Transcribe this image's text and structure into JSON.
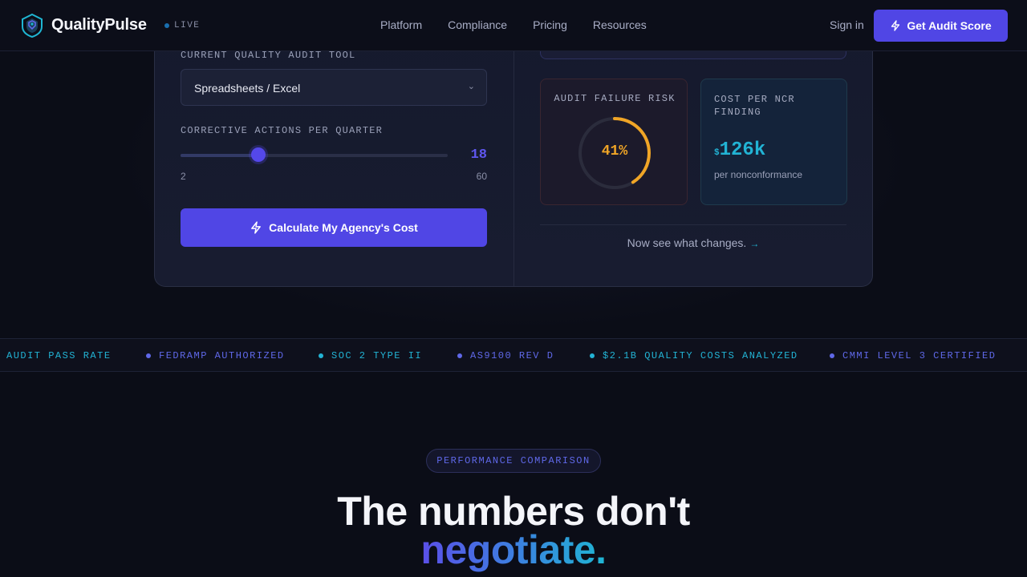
{
  "nav": {
    "brand": "QualityPulse",
    "live_label": "LIVE",
    "links": [
      "Platform",
      "Compliance",
      "Pricing",
      "Resources"
    ],
    "signin": "Sign in",
    "cta": "Get Audit Score"
  },
  "calculator": {
    "tool_label": "CURRENT QUALITY AUDIT TOOL",
    "tool_value": "Spreadsheets / Excel",
    "actions_label": "CORRECTIVE ACTIONS PER QUARTER",
    "actions_value": "18",
    "actions_fraction": 0.29,
    "actions_min": "2",
    "actions_max": "60",
    "calc_button": "Calculate My Agency's Cost",
    "risk_title": "AUDIT FAILURE RISK",
    "risk_value": "41%",
    "risk_fraction": 0.41,
    "cost_title": "COST PER NCR FINDING",
    "cost_currency": "$",
    "cost_value": "126k",
    "cost_sub": "per nonconformance",
    "see_changes": "Now see what changes."
  },
  "ticker": [
    {
      "text": "AUDIT PASS RATE",
      "color": "#22b3d4"
    },
    {
      "text": "FEDRAMP AUTHORIZED",
      "color": "#5f68e8"
    },
    {
      "text": "SOC 2 TYPE II",
      "color": "#22b3d4"
    },
    {
      "text": "AS9100 REV D",
      "color": "#5f68e8"
    },
    {
      "text": "$2.1B QUALITY COSTS ANALYZED",
      "color": "#22b3d4"
    },
    {
      "text": "CMMI LEVEL 3 CERTIFIED",
      "color": "#5f68e8"
    }
  ],
  "section": {
    "pill": "PERFORMANCE COMPARISON",
    "headline_1": "The numbers don't",
    "headline_2": "negotiate."
  },
  "colors": {
    "accent": "#5046e5",
    "cyan": "#22b3d4",
    "amber": "#f0a526",
    "background": "#0b0d17"
  }
}
